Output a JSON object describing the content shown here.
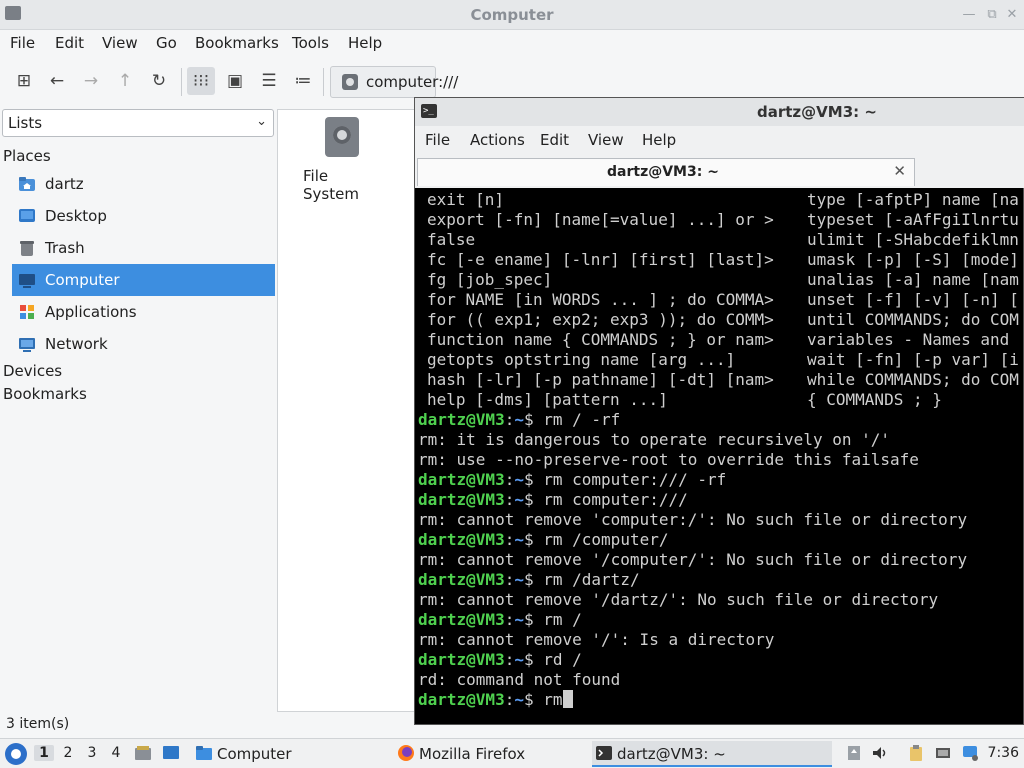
{
  "file_manager": {
    "title": "Computer",
    "menu": [
      "File",
      "Edit",
      "View",
      "Go",
      "Bookmarks",
      "Tools",
      "Help"
    ],
    "path": "computer:///",
    "sidebar_mode": "Lists",
    "places_header": "Places",
    "places": [
      {
        "label": "dartz",
        "icon": "home-folder-icon"
      },
      {
        "label": "Desktop",
        "icon": "desktop-icon"
      },
      {
        "label": "Trash",
        "icon": "trash-icon"
      },
      {
        "label": "Computer",
        "icon": "computer-icon",
        "selected": true
      },
      {
        "label": "Applications",
        "icon": "applications-icon"
      },
      {
        "label": "Network",
        "icon": "network-icon"
      }
    ],
    "devices_header": "Devices",
    "bookmarks_header": "Bookmarks",
    "items": [
      {
        "label": "File System",
        "icon": "drive-icon"
      }
    ],
    "status": "3 item(s)"
  },
  "terminal": {
    "title": "dartz@VM3: ~",
    "menu": [
      "File",
      "Actions",
      "Edit",
      "View",
      "Help"
    ],
    "tab_title": "dartz@VM3: ~",
    "help_left": [
      "exit [n]",
      "export [-fn] [name[=value] ...] or >",
      "false",
      "fc [-e ename] [-lnr] [first] [last]>",
      "fg [job_spec]",
      "for NAME [in WORDS ... ] ; do COMMA>",
      "for (( exp1; exp2; exp3 )); do COMM>",
      "function name { COMMANDS ; } or nam>",
      "getopts optstring name [arg ...]",
      "hash [-lr] [-p pathname] [-dt] [nam>",
      "help [-dms] [pattern ...]"
    ],
    "help_right": [
      "type [-afptP] name [na",
      "typeset [-aAfFgiIlnrtu",
      "ulimit [-SHabcdefiklmn",
      "umask [-p] [-S] [mode]",
      "unalias [-a] name [nam",
      "unset [-f] [-v] [-n] [",
      "until COMMANDS; do COM",
      "variables - Names and",
      "wait [-fn] [-p var] [i",
      "while COMMANDS; do COM",
      "{ COMMANDS ; }"
    ],
    "prompt_user": "dartz@VM3",
    "prompt_path": "~",
    "session": [
      {
        "type": "cmd",
        "text": "rm / -rf"
      },
      {
        "type": "out",
        "text": "rm: it is dangerous to operate recursively on '/'"
      },
      {
        "type": "out",
        "text": "rm: use --no-preserve-root to override this failsafe"
      },
      {
        "type": "cmd",
        "text": "rm computer:/// -rf"
      },
      {
        "type": "cmd",
        "text": "rm computer:///"
      },
      {
        "type": "out",
        "text": "rm: cannot remove 'computer:/': No such file or directory"
      },
      {
        "type": "cmd",
        "text": "rm /computer/"
      },
      {
        "type": "out",
        "text": "rm: cannot remove '/computer/': No such file or directory"
      },
      {
        "type": "cmd",
        "text": "rm /dartz/"
      },
      {
        "type": "out",
        "text": "rm: cannot remove '/dartz/': No such file or directory"
      },
      {
        "type": "cmd",
        "text": "rm /"
      },
      {
        "type": "out",
        "text": "rm: cannot remove '/': Is a directory"
      },
      {
        "type": "cmd",
        "text": "rd /"
      },
      {
        "type": "out",
        "text": "rd: command not found"
      },
      {
        "type": "cmd",
        "text": "rm",
        "cursor": true
      }
    ]
  },
  "taskbar": {
    "workspaces": [
      "1",
      "2",
      "3",
      "4"
    ],
    "tasks": [
      {
        "label": "Computer",
        "icon": "folder-icon"
      },
      {
        "label": "Mozilla Firefox",
        "icon": "firefox-icon"
      },
      {
        "label": "dartz@VM3: ~",
        "icon": "terminal-icon",
        "active": true
      }
    ],
    "clock": "7:36"
  },
  "colors": {
    "accent": "#3d8ee0",
    "prompt_user": "#4fd14f",
    "prompt_path": "#5c9df5"
  }
}
